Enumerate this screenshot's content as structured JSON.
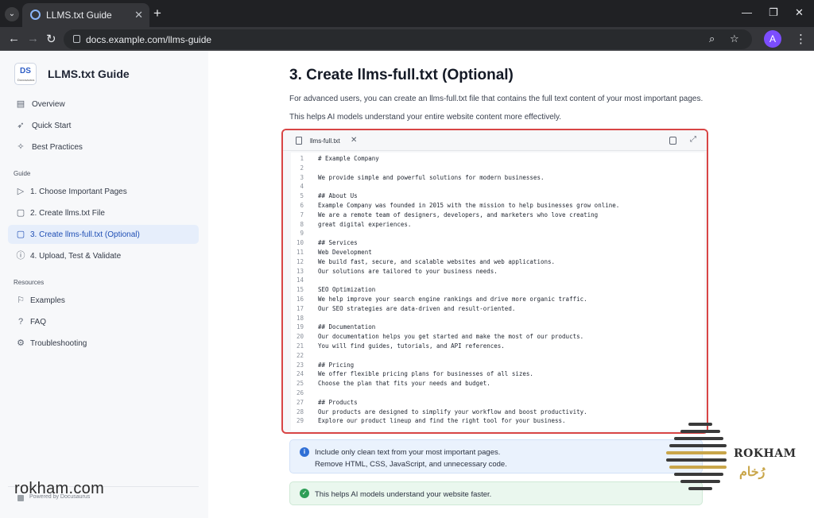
{
  "browser": {
    "tab_title": "LLMS.txt Guide",
    "url": "docs.example.com/llms-guide",
    "profile_initial": "A",
    "accent": "#202124"
  },
  "sidebar": {
    "brand_title": "LLMS.txt Guide",
    "brand_mark": "DS",
    "brand_sub": "Docusaurus",
    "top_items": [
      {
        "label": "Overview",
        "icon": "book-icon"
      },
      {
        "label": "Quick Start",
        "icon": "rocket-icon"
      },
      {
        "label": "Best Practices",
        "icon": "pin-icon"
      }
    ],
    "guide_heading": "Guide",
    "guide_items": [
      {
        "label": "1. Choose Important Pages",
        "icon": "chevron-right-icon"
      },
      {
        "label": "2. Create llms.txt File",
        "icon": "document-icon"
      },
      {
        "label": "3. Create llms-full.txt (Optional)",
        "icon": "document-icon",
        "active": true
      },
      {
        "label": "4. Upload, Test & Validate",
        "icon": "info-circle-icon"
      }
    ],
    "resources_heading": "Resources",
    "resource_items": [
      {
        "label": "Examples",
        "icon": "flag-icon"
      },
      {
        "label": "FAQ",
        "icon": "question-icon"
      },
      {
        "label": "Troubleshooting",
        "icon": "settings-icon"
      }
    ],
    "powered_by": "Powered by Docusaurus"
  },
  "main": {
    "title": "3. Create llms-full.txt (Optional)",
    "para1": "For advanced users, you can create an llms-full.txt file that contains the full text content of your most important pages.",
    "para2": "This helps AI models understand your entire website content more effectively.",
    "editor": {
      "file_name": "llms-full.txt",
      "lines": [
        "# Example Company",
        "",
        "We provide simple and powerful solutions for modern businesses.",
        "",
        "## About Us",
        "Example Company was founded in 2015 with the mission to help businesses grow online.",
        "We are a remote team of designers, developers, and marketers who love creating",
        "great digital experiences.",
        "",
        "## Services",
        "Web Development",
        "We build fast, secure, and scalable websites and web applications.",
        "Our solutions are tailored to your business needs.",
        "",
        "SEO Optimization",
        "We help improve your search engine rankings and drive more organic traffic.",
        "Our SEO strategies are data-driven and result-oriented.",
        "",
        "## Documentation",
        "Our documentation helps you get started and make the most of our products.",
        "You will find guides, tutorials, and API references.",
        "",
        "## Pricing",
        "We offer flexible pricing plans for businesses of all sizes.",
        "Choose the plan that fits your needs and budget.",
        "",
        "## Products",
        "Our products are designed to simplify your workflow and boost productivity.",
        "Explore our product lineup and find the right tool for your business."
      ]
    },
    "info_callout": {
      "line1": "Include only clean text from your most important pages.",
      "line2": "Remove HTML, CSS, JavaScript, and unnecessary code."
    },
    "success_callout": {
      "line1": "This helps AI models understand your website faster."
    }
  },
  "watermark": {
    "left_text": "rokham.com",
    "right_text": "ROKHAM",
    "right_text_ar": "رُخام"
  },
  "colors": {
    "highlight_border": "#d84545",
    "active_nav": "#1f4fb5",
    "info_blue": "#2f6fd6",
    "success_green": "#2e9e57"
  }
}
